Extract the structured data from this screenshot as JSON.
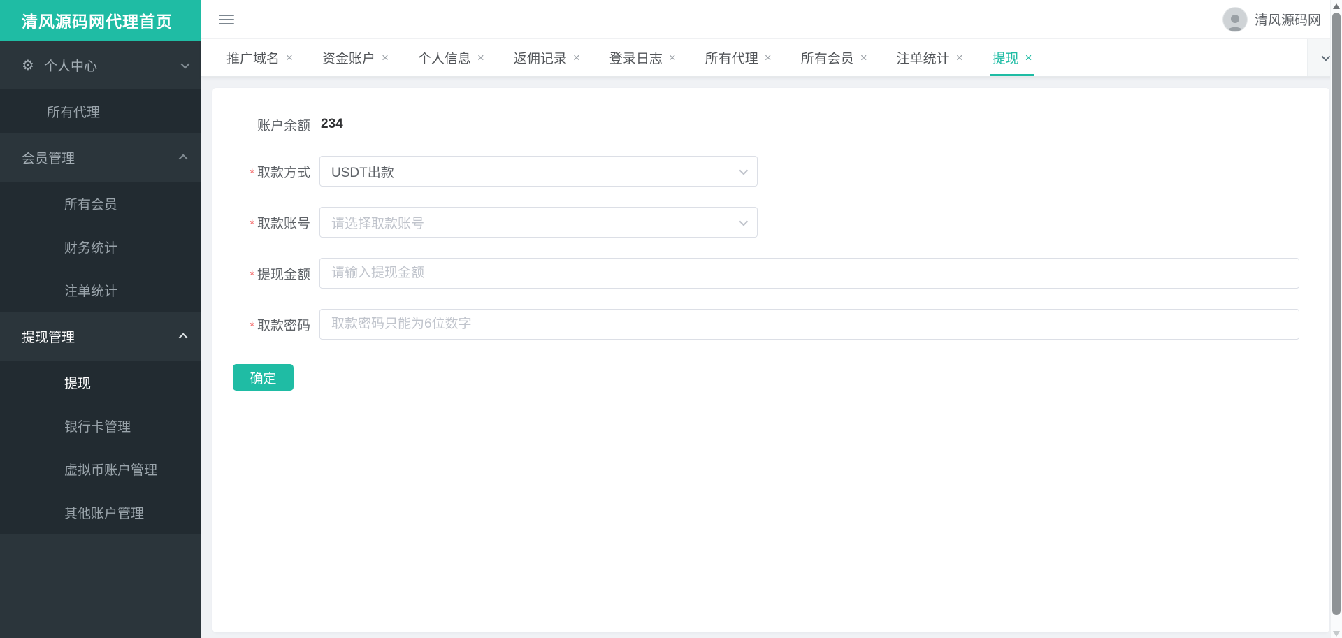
{
  "app": {
    "title": "清风源码网代理首页",
    "user_name": "清风源码网",
    "icons": {
      "gear_glyph": "⚙",
      "close_glyph": "×"
    }
  },
  "colors": {
    "accent": "#1fbca4",
    "sidebar_bg": "#2b353b",
    "submenu_bg": "#222b31",
    "page_bg": "#f0f2f5",
    "required_red": "#f56c6c"
  },
  "sidebar": {
    "items": [
      {
        "label": "个人中心",
        "type": "group",
        "icon": "gear",
        "chevron": "down",
        "active": false
      },
      {
        "label": "所有代理",
        "type": "subitem",
        "active": false
      },
      {
        "label": "会员管理",
        "type": "group",
        "chevron": "up",
        "active": false
      },
      {
        "label": "所有会员",
        "type": "subitem",
        "active": false
      },
      {
        "label": "财务统计",
        "type": "subitem",
        "active": false
      },
      {
        "label": "注单统计",
        "type": "subitem",
        "active": false
      },
      {
        "label": "提现管理",
        "type": "group",
        "chevron": "up",
        "active": true
      },
      {
        "label": "提现",
        "type": "subitem",
        "active": true
      },
      {
        "label": "银行卡管理",
        "type": "subitem",
        "active": false
      },
      {
        "label": "虚拟币账户管理",
        "type": "subitem",
        "active": false
      },
      {
        "label": "其他账户管理",
        "type": "subitem",
        "active": false
      }
    ]
  },
  "tabs": {
    "close_glyph": "×",
    "items": [
      {
        "label": "推广域名",
        "active": false
      },
      {
        "label": "资金账户",
        "active": false
      },
      {
        "label": "个人信息",
        "active": false
      },
      {
        "label": "返佣记录",
        "active": false
      },
      {
        "label": "登录日志",
        "active": false
      },
      {
        "label": "所有代理",
        "active": false
      },
      {
        "label": "所有会员",
        "active": false
      },
      {
        "label": "注单统计",
        "active": false
      },
      {
        "label": "提现",
        "active": true
      }
    ]
  },
  "form": {
    "balance_label": "账户余额",
    "balance_value": "234",
    "required_mark": "*",
    "fields": [
      {
        "label": "取款方式",
        "type": "select",
        "value": "USDT出款",
        "required": true
      },
      {
        "label": "取款账号",
        "type": "select",
        "placeholder": "请选择取款账号",
        "required": true
      },
      {
        "label": "提现金额",
        "type": "input",
        "placeholder": "请输入提现金额",
        "required": true
      },
      {
        "label": "取款密码",
        "type": "input",
        "placeholder": "取款密码只能为6位数字",
        "required": true
      }
    ],
    "submit_label": "确定"
  }
}
